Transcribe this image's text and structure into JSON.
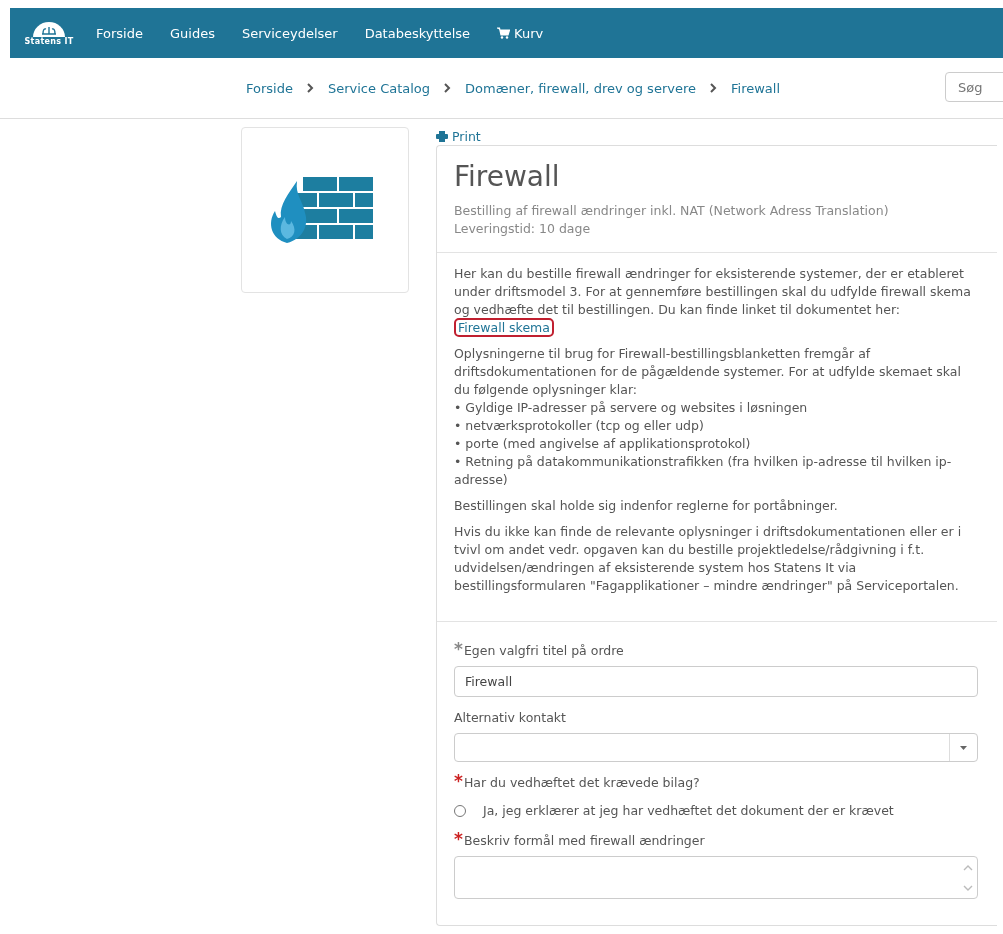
{
  "nav": {
    "logo": "Statens IT",
    "items": [
      "Forside",
      "Guides",
      "Serviceydelser",
      "Databeskyttelse"
    ],
    "cart": "Kurv"
  },
  "breadcrumb": [
    "Forside",
    "Service Catalog",
    "Domæner, firewall, drev og servere",
    "Firewall"
  ],
  "search": {
    "placeholder": "Søg"
  },
  "print": "Print",
  "item": {
    "title": "Firewall",
    "subtitle": "Bestilling af firewall ændringer inkl. NAT (Network Adress Translation)",
    "delivery": "Leveringstid: 10 dage"
  },
  "description": {
    "intro": "Her kan du bestille firewall ændringer for eksisterende systemer, der er etableret under driftsmodel 3. For at gennemføre bestillingen skal du udfylde firewall skema og vedhæfte det til bestillingen. Du kan finde linket til dokumentet her:",
    "link": "Firewall skema",
    "info": "Oplysningerne til brug for Firewall-bestillingsblanketten fremgår af driftsdokumentationen for de pågældende systemer. For at udfylde skemaet skal du følgende oplysninger klar:",
    "bullets": [
      "• Gyldige IP-adresser på servere og websites i løsningen",
      "• netværksprotokoller (tcp og eller udp)",
      "• porte (med angivelse af applikationsprotokol)",
      "• Retning på datakommunikationstrafikken (fra hvilken ip-adresse til hvilken ip-adresse)"
    ],
    "paragraphs": [
      "Bestillingen skal holde sig indenfor reglerne for portåbninger.",
      "Hvis du ikke kan finde de relevante oplysninger i driftsdokumentationen eller er i tvivl om andet vedr. opgaven kan du bestille projektledelse/rådgivning i f.t. udvidelsen/ændringen af eksisterende system hos Statens It via bestillingsformularen \"Fagapplikationer – mindre ændringer\" på Serviceportalen."
    ]
  },
  "fields": [
    {
      "kind": "text",
      "label": "Egen valgfri titel på ordre",
      "required": "*",
      "color": "#888888",
      "value": "Firewall"
    },
    {
      "kind": "select",
      "label": "Alternativ kontakt"
    },
    {
      "kind": "radio",
      "label": "Har du vedhæftet det krævede bilag?",
      "required": "*",
      "color": "#cc2222",
      "option": "Ja, jeg erklærer at jeg har vedhæftet det dokument der er krævet",
      "checked": false
    },
    {
      "kind": "textarea",
      "label": "Beskriv formål med firewall ændringer",
      "required": "*",
      "color": "#cc2222"
    }
  ]
}
